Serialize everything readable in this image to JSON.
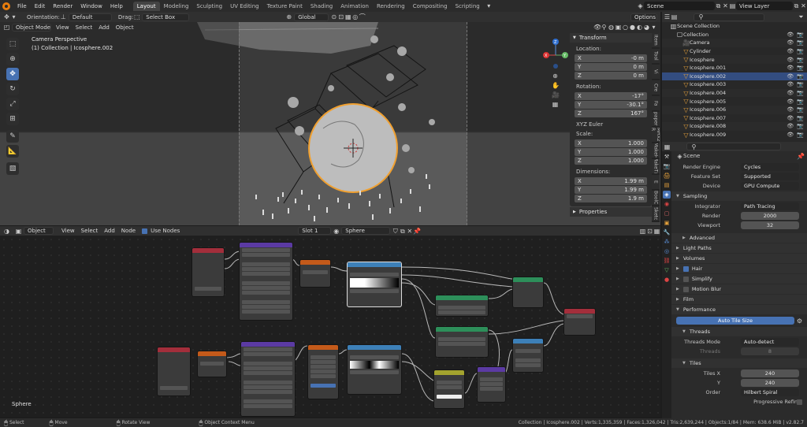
{
  "menu": {
    "items": [
      "File",
      "Edit",
      "Render",
      "Window",
      "Help"
    ]
  },
  "workspaces": [
    "Layout",
    "Modeling",
    "Sculpting",
    "UV Editing",
    "Texture Paint",
    "Shading",
    "Animation",
    "Rendering",
    "Compositing",
    "Scripting"
  ],
  "active_workspace": "Layout",
  "scene_field": "Scene",
  "view_layer_field": "View Layer",
  "tool_header": {
    "orientation_label": "Orientation:",
    "orientation_value": "Default",
    "drag_label": "Drag:",
    "drag_value": "Select Box",
    "transform_orientation": "Global",
    "options_label": "Options"
  },
  "viewport_header": {
    "mode": "Object Mode",
    "menus": [
      "View",
      "Select",
      "Add",
      "Object"
    ]
  },
  "viewport": {
    "overlay_line1": "Camera Perspective",
    "overlay_line2": "(1) Collection | Icosphere.002",
    "gizmo": {
      "x": "X",
      "y": "Y",
      "z": "Z"
    }
  },
  "npanel": {
    "title": "Transform",
    "location_label": "Location:",
    "location": [
      {
        "axis": "X",
        "value": "-0 m"
      },
      {
        "axis": "Y",
        "value": "0 m"
      },
      {
        "axis": "Z",
        "value": "0 m"
      }
    ],
    "rotation_label": "Rotation:",
    "rotation": [
      {
        "axis": "X",
        "value": "-17°"
      },
      {
        "axis": "Y",
        "value": "-30.1°"
      },
      {
        "axis": "Z",
        "value": "167°"
      }
    ],
    "rotation_mode": "XYZ Euler",
    "scale_label": "Scale:",
    "scale": [
      {
        "axis": "X",
        "value": "1.000"
      },
      {
        "axis": "Y",
        "value": "1.000"
      },
      {
        "axis": "Z",
        "value": "1.000"
      }
    ],
    "dimensions_label": "Dimensions:",
    "dimensions": [
      {
        "axis": "X",
        "value": "1.99 m"
      },
      {
        "axis": "Y",
        "value": "1.99 m"
      },
      {
        "axis": "Z",
        "value": "1.9 m"
      }
    ],
    "properties_label": "Properties",
    "side_tabs": [
      "Item",
      "Tool",
      "Vi",
      "Cre",
      "Fa",
      "paper",
      "MHX2 R",
      "MakeH",
      "MakeTx",
      "E",
      "BoolC",
      "Sketc"
    ]
  },
  "node_header": {
    "type": "Object",
    "menus": [
      "View",
      "Select",
      "Add",
      "Node"
    ],
    "use_nodes": "Use Nodes",
    "slot": "Slot 1",
    "material": "Sphere"
  },
  "node_editor": {
    "material_label": "Sphere"
  },
  "outliner": {
    "header_title": "Scene Collection",
    "rows": [
      {
        "name": "Collection",
        "indent": 1,
        "selected": false
      },
      {
        "name": "Camera",
        "indent": 2,
        "selected": false
      },
      {
        "name": "Cylinder",
        "indent": 2,
        "selected": false
      },
      {
        "name": "Icosphere",
        "indent": 2,
        "selected": false
      },
      {
        "name": "Icosphere.001",
        "indent": 2,
        "selected": false
      },
      {
        "name": "Icosphere.002",
        "indent": 2,
        "selected": true
      },
      {
        "name": "Icosphere.003",
        "indent": 2,
        "selected": false
      },
      {
        "name": "Icosphere.004",
        "indent": 2,
        "selected": false
      },
      {
        "name": "Icosphere.005",
        "indent": 2,
        "selected": false
      },
      {
        "name": "Icosphere.006",
        "indent": 2,
        "selected": false
      },
      {
        "name": "Icosphere.007",
        "indent": 2,
        "selected": false
      },
      {
        "name": "Icosphere.008",
        "indent": 2,
        "selected": false
      },
      {
        "name": "Icosphere.009",
        "indent": 2,
        "selected": false
      }
    ]
  },
  "properties": {
    "context": "Scene",
    "render_engine_label": "Render Engine",
    "render_engine": "Cycles",
    "feature_set_label": "Feature Set",
    "feature_set": "Supported",
    "device_label": "Device",
    "device": "GPU Compute",
    "sampling": "Sampling",
    "integrator_label": "Integrator",
    "integrator": "Path Tracing",
    "render_label": "Render",
    "render_samples": "2000",
    "viewport_label": "Viewport",
    "viewport_samples": "32",
    "advanced": "Advanced",
    "light_paths": "Light Paths",
    "volumes": "Volumes",
    "hair": "Hair",
    "simplify": "Simplify",
    "motion_blur": "Motion Blur",
    "film": "Film",
    "performance": "Performance",
    "auto_tile_size": "Auto Tile Size",
    "threads": "Threads",
    "threads_mode_label": "Threads Mode",
    "threads_mode": "Auto-detect",
    "threads_label": "Threads",
    "threads_value": "8",
    "tiles": "Tiles",
    "tiles_x_label": "Tiles X",
    "tiles_x": "240",
    "y_label": "Y",
    "tiles_y": "240",
    "order_label": "Order",
    "order": "Hilbert Spiral",
    "progressive_refine": "Progressive Refine"
  },
  "statusbar": {
    "select": "Select",
    "move": "Move",
    "rotate_view": "Rotate View",
    "context_menu": "Object Context Menu",
    "stats": "Collection | Icosphere.002 | Verts:1,335,359 | Faces:1,326,042 | Tris:2,639,244 | Objects:1/84 | Mem: 638.6 MiB | v2.82.7"
  },
  "colors": {
    "accent": "#4772b3",
    "selection_orange": "#f0a030",
    "selected_row": "#334d80"
  }
}
